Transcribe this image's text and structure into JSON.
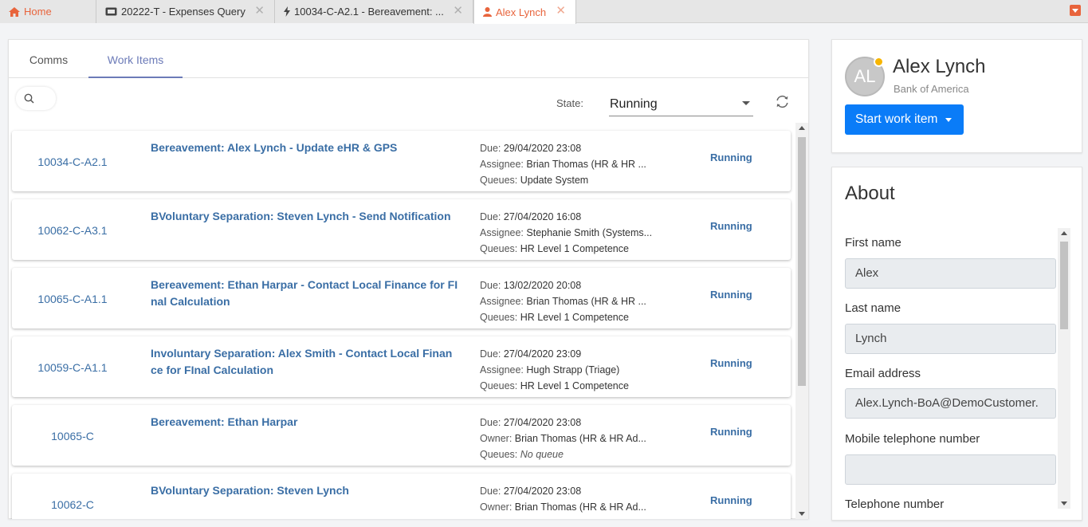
{
  "tabs": [
    {
      "label": "Home",
      "icon": "home-icon",
      "active": false
    },
    {
      "label": "20222-T - Expenses Query",
      "icon": "ticket-icon",
      "active": false
    },
    {
      "label": "10034-C-A2.1 - Bereavement: ...",
      "icon": "lightning-icon",
      "active": false
    },
    {
      "label": "Alex Lynch",
      "icon": "user-icon",
      "active": true
    }
  ],
  "subtabs": {
    "comms": "Comms",
    "work_items": "Work Items"
  },
  "filter": {
    "state_label": "State:",
    "state_value": "Running"
  },
  "work_items": [
    {
      "id": "10034-C-A2.1",
      "title": "Bereavement: Alex Lynch - Update eHR & GPS",
      "due_label": "Due:",
      "due": "29/04/2020 23:08",
      "person_label": "Assignee:",
      "person": "Brian Thomas (HR & HR ...",
      "queues_label": "Queues:",
      "queues": "Update System",
      "status": "Running"
    },
    {
      "id": "10062-C-A3.1",
      "title": "BVoluntary Separation: Steven Lynch - Send Notification",
      "due_label": "Due:",
      "due": "27/04/2020 16:08",
      "person_label": "Assignee:",
      "person": "Stephanie Smith (Systems...",
      "queues_label": "Queues:",
      "queues": "HR Level 1 Competence",
      "status": "Running"
    },
    {
      "id": "10065-C-A1.1",
      "title": "Bereavement: Ethan Harpar - Contact Local Finance for FI nal Calculation",
      "due_label": "Due:",
      "due": "13/02/2020 20:08",
      "person_label": "Assignee:",
      "person": "Brian Thomas (HR & HR ...",
      "queues_label": "Queues:",
      "queues": "HR Level 1 Competence",
      "status": "Running"
    },
    {
      "id": "10059-C-A1.1",
      "title": "Involuntary Separation: Alex Smith - Contact Local Finan ce for FInal Calculation",
      "due_label": "Due:",
      "due": "27/04/2020 23:09",
      "person_label": "Assignee:",
      "person": "Hugh Strapp (Triage)",
      "queues_label": "Queues:",
      "queues": "HR Level 1 Competence",
      "status": "Running"
    },
    {
      "id": "10065-C",
      "title": "Bereavement: Ethan Harpar",
      "due_label": "Due:",
      "due": "27/04/2020 23:08",
      "person_label": "Owner:",
      "person": "Brian Thomas (HR & HR Ad...",
      "queues_label": "Queues:",
      "queues": "No queue",
      "status": "Running"
    },
    {
      "id": "10062-C",
      "title": "BVoluntary Separation: Steven Lynch",
      "due_label": "Due:",
      "due": "27/04/2020 23:08",
      "person_label": "Owner:",
      "person": "Brian Thomas (HR & HR Ad...",
      "queues_label": "Queues:",
      "queues": "",
      "status": "Running"
    }
  ],
  "profile": {
    "initials": "AL",
    "name": "Alex Lynch",
    "organization": "Bank of America",
    "start_button": "Start work item",
    "presence_color": "#f7b500"
  },
  "about": {
    "title": "About",
    "fields": [
      {
        "label": "First name",
        "value": "Alex"
      },
      {
        "label": "Last name",
        "value": "Lynch"
      },
      {
        "label": "Email address",
        "value": "Alex.Lynch-BoA@DemoCustomer."
      },
      {
        "label": "Mobile telephone number",
        "value": ""
      },
      {
        "label": "Telephone number",
        "value": ""
      }
    ]
  },
  "colors": {
    "accent_orange": "#e8643c",
    "link_blue": "#3a6ea5",
    "primary_button": "#0a7cf8",
    "active_subtab": "#6c7bb8"
  }
}
